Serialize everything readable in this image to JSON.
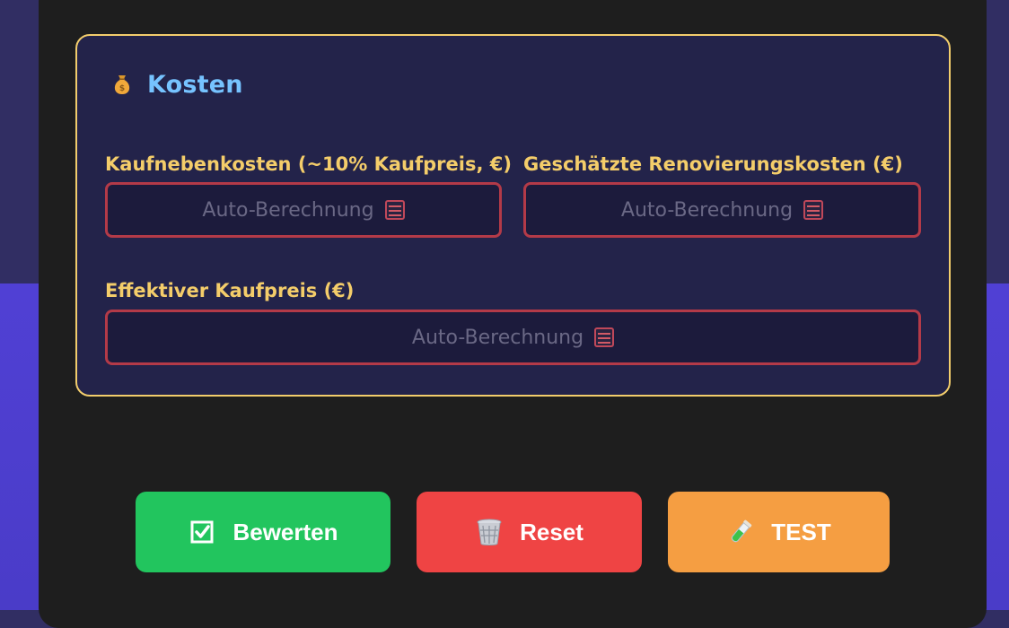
{
  "section": {
    "icon": "money-bag-icon",
    "title": "Kosten"
  },
  "fields": {
    "kaufnebenkosten": {
      "label": "Kaufnebenkosten (~10% Kaufpreis, €)",
      "placeholder": "Auto-Berechnung",
      "icon": "abacus-icon"
    },
    "renovierung": {
      "label": "Geschätzte Renovierungskosten (€)",
      "placeholder": "Auto-Berechnung",
      "icon": "abacus-icon"
    },
    "effektiv": {
      "label": "Effektiver Kaufpreis (€)",
      "placeholder": "Auto-Berechnung",
      "icon": "abacus-icon"
    }
  },
  "buttons": {
    "bewerten": {
      "label": "Bewerten",
      "icon": "checkbox-icon",
      "color": "#22c55e"
    },
    "reset": {
      "label": "Reset",
      "icon": "wastebasket-icon",
      "color": "#ef4444"
    },
    "test": {
      "label": "TEST",
      "icon": "test-tube-icon",
      "color": "#f59e42"
    }
  },
  "colors": {
    "section_border": "#f2cd6c",
    "title": "#76c3ff",
    "label": "#f4cd6a",
    "field_border": "#b33a48"
  }
}
